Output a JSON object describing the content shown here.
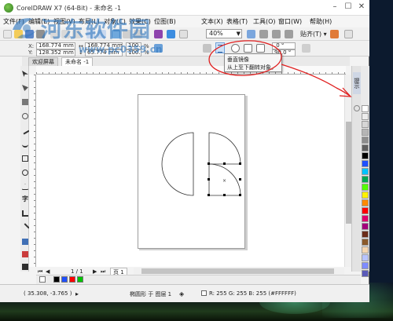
{
  "window": {
    "title": "CorelDRAW X7 (64-Bit) - 未命名 -1"
  },
  "menubar": {
    "items": [
      "文件(F)",
      "编辑(E)",
      "视图(V)",
      "布局(L)",
      "对象(C)",
      "效果(C)",
      "位图(B)",
      "文本(X)",
      "表格(T)",
      "工具(O)",
      "窗口(W)",
      "帮助(H)"
    ]
  },
  "toolbar": {
    "zoom_value": "40%",
    "snap_label": "贴齐(T)"
  },
  "propbar": {
    "x_label": "X:",
    "x_value": "168.774 mm",
    "y_label": "Y:",
    "y_value": "128.352 mm",
    "w_value": "168.774 mm",
    "h_value": "65.774 mm",
    "scale_x": "100.0",
    "scale_y": "100.0",
    "pct": "%",
    "angle_value": ".0 °",
    "angle2_value": "90.0 °"
  },
  "tabs": [
    {
      "label": "欢迎屏幕"
    },
    {
      "label": "未命名 -1"
    }
  ],
  "tooltip": {
    "title": "垂直镜像",
    "body": "从上至下翻转对象。"
  },
  "pagenav": {
    "page_count": "1 / 1",
    "page_tab": "页 1"
  },
  "hints": {
    "label": "提示"
  },
  "statusbar": {
    "coords": "( 35.308, -3.765 )",
    "object_info": "椭圆形 于 图层 1",
    "fill_info": "R: 255 G: 255 B: 255 (#FFFFFF)"
  },
  "watermark": {
    "text": "河东软件园",
    "url": "www.pc0359.cn"
  },
  "palette": {
    "colors": [
      "#ffffff",
      "#ececec",
      "#d6d6d6",
      "#b5b5b5",
      "#8d8d8d",
      "#5f5f5f",
      "#000000",
      "#1f4fff",
      "#00c2ff",
      "#00a651",
      "#54ff00",
      "#fff200",
      "#ff8a00",
      "#ff0000",
      "#e0006b",
      "#a3007a",
      "#6b2d1a",
      "#8a5a2b",
      "#f5d6b0",
      "#b8c4ff",
      "#7f8cff",
      "#5a5ab8"
    ]
  },
  "doc_colors": [
    "#000000",
    "#1f4fff",
    "#ff0000",
    "#00c400"
  ]
}
